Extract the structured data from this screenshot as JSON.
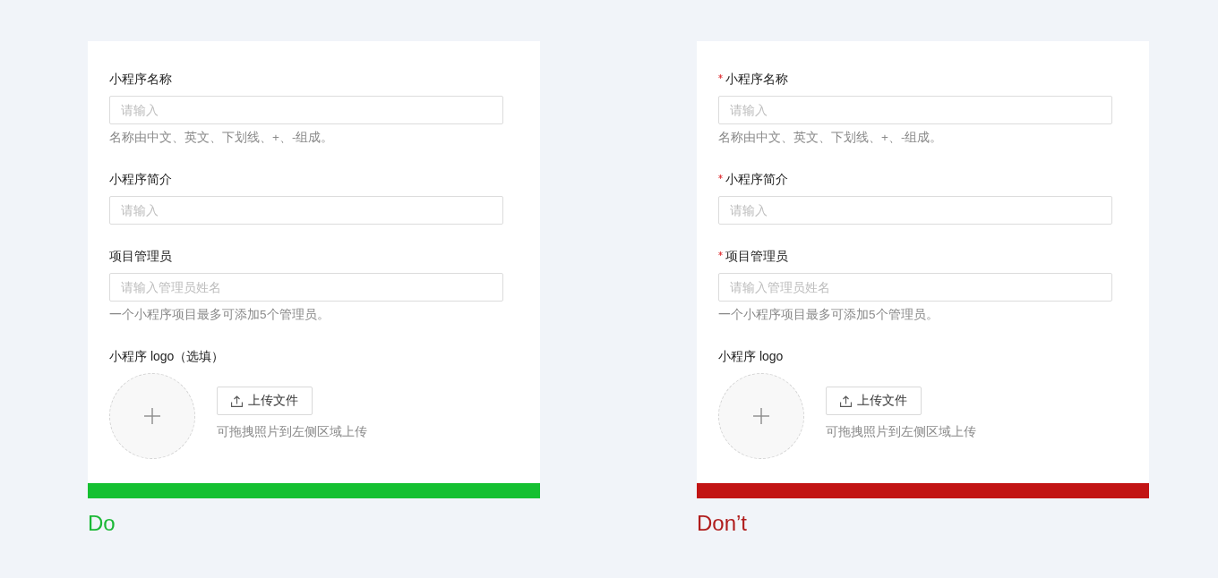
{
  "panels": [
    {
      "kind": "do",
      "verdict": "Do",
      "fields": [
        {
          "kind": "text",
          "label": "小程序名称",
          "required": false,
          "placeholder": "请输入",
          "hint": "名称由中文、英文、下划线、+、-组成。"
        },
        {
          "kind": "text",
          "label": "小程序简介",
          "required": false,
          "placeholder": "请输入"
        },
        {
          "kind": "text",
          "label": "项目管理员",
          "required": false,
          "placeholder": "请输入管理员姓名",
          "hint": "一个小程序项目最多可添加5个管理员。"
        },
        {
          "kind": "upload",
          "label": "小程序 logo（选填）",
          "required": false,
          "button": "上传文件",
          "hint": "可拖拽照片到左侧区域上传"
        }
      ]
    },
    {
      "kind": "dont",
      "verdict": "Don’t",
      "fields": [
        {
          "kind": "text",
          "label": "小程序名称",
          "required": true,
          "placeholder": "请输入",
          "hint": "名称由中文、英文、下划线、+、-组成。"
        },
        {
          "kind": "text",
          "label": "小程序简介",
          "required": true,
          "placeholder": "请输入"
        },
        {
          "kind": "text",
          "label": "项目管理员",
          "required": true,
          "placeholder": "请输入管理员姓名",
          "hint": "一个小程序项目最多可添加5个管理员。"
        },
        {
          "kind": "upload",
          "label": "小程序 logo",
          "required": false,
          "button": "上传文件",
          "hint": "可拖拽照片到左侧区域上传"
        }
      ]
    }
  ]
}
